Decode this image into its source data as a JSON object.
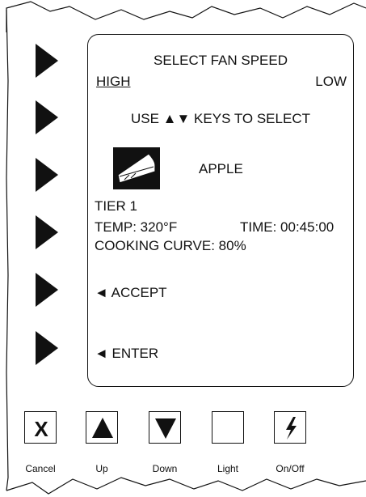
{
  "screen": {
    "title": "SELECT FAN SPEED",
    "option_high": "HIGH",
    "option_low": "LOW",
    "instruction": "USE ▲▼ KEYS TO SELECT",
    "product_icon": "pie-slice-icon",
    "product_name": "APPLE",
    "tier": "TIER 1",
    "temp": "TEMP: 320°F",
    "time": "TIME: 00:45:00",
    "cooking_curve": "COOKING CURVE: 80%",
    "accept": "◄ ACCEPT",
    "enter": "◄ ENTER"
  },
  "softkeys": [
    "softkey-arrow-icon",
    "softkey-arrow-icon",
    "softkey-arrow-icon",
    "softkey-arrow-icon",
    "softkey-arrow-icon",
    "softkey-arrow-icon"
  ],
  "hardkeys": {
    "cancel": {
      "label": "Cancel",
      "icon": "x-icon"
    },
    "up": {
      "label": "Up",
      "icon": "up-triangle-icon"
    },
    "down": {
      "label": "Down",
      "icon": "down-triangle-icon"
    },
    "light": {
      "label": "Light",
      "icon": "blank"
    },
    "onoff": {
      "label": "On/Off",
      "icon": "lightning-bolt-icon"
    }
  },
  "colors": {
    "ink": "#111111",
    "background": "#ffffff"
  }
}
